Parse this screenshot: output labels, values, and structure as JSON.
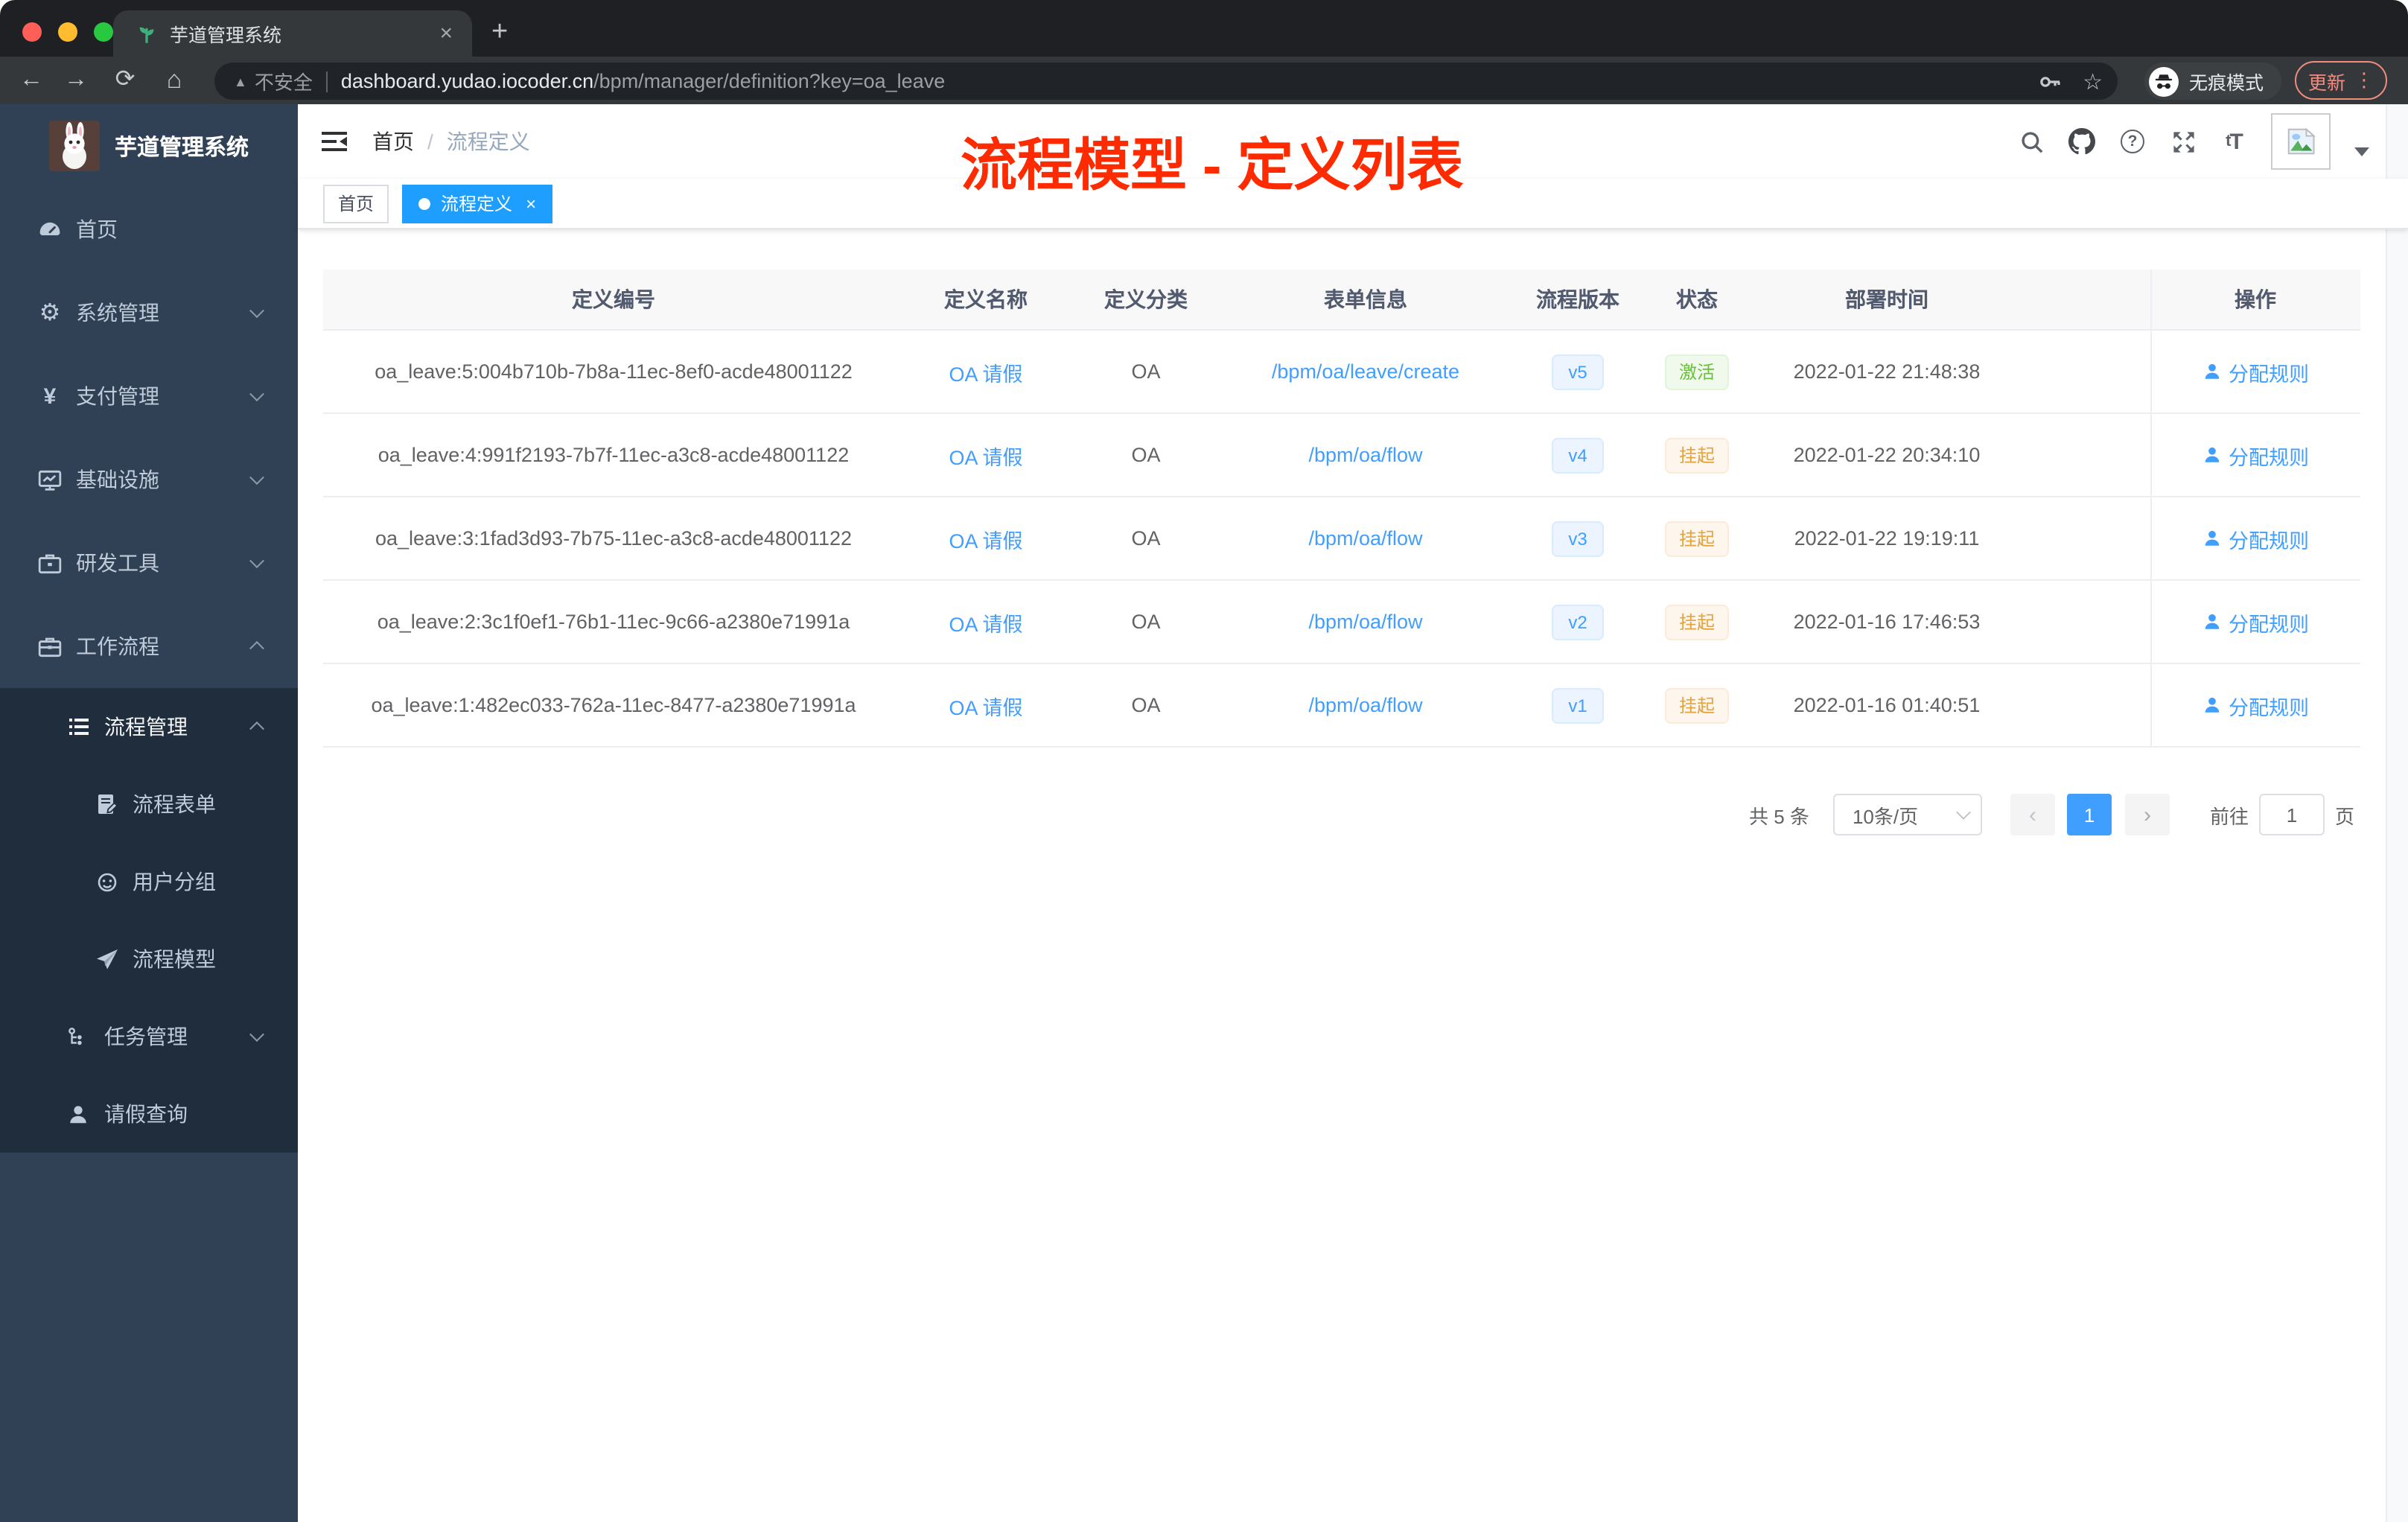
{
  "chrome": {
    "tab_title": "芋道管理系统",
    "not_secure": "不安全",
    "url_host": "dashboard.yudao.iocoder.cn",
    "url_path": "/bpm/manager/definition?key=oa_leave",
    "incognito_label": "无痕模式",
    "update_label": "更新"
  },
  "icons": {
    "back": "←",
    "forward": "→",
    "reload": "⟳",
    "home": "⌂",
    "warning": "▲",
    "star": "☆",
    "new_tab": "+",
    "close": "×",
    "more": "⋮",
    "gear": "⚙",
    "yen": "¥",
    "help": "?",
    "text_small": "t",
    "text_large": "T"
  },
  "sidebar": {
    "app_title": "芋道管理系统",
    "menu": [
      {
        "label": "首页"
      },
      {
        "label": "系统管理"
      },
      {
        "label": "支付管理"
      },
      {
        "label": "基础设施"
      },
      {
        "label": "研发工具"
      },
      {
        "label": "工作流程"
      }
    ],
    "submenu": [
      {
        "label": "流程管理"
      },
      {
        "label": "流程表单"
      },
      {
        "label": "用户分组"
      },
      {
        "label": "流程模型"
      },
      {
        "label": "任务管理"
      },
      {
        "label": "请假查询"
      }
    ]
  },
  "navbar": {
    "breadcrumb_home": "首页",
    "breadcrumb_sep": "/",
    "breadcrumb_current": "流程定义",
    "annotation": "流程模型 - 定义列表"
  },
  "tags": {
    "home": "首页",
    "active": "流程定义"
  },
  "table": {
    "columns": [
      "定义编号",
      "定义名称",
      "定义分类",
      "表单信息",
      "流程版本",
      "状态",
      "部署时间",
      "操作"
    ],
    "rows": [
      {
        "id": "oa_leave:5:004b710b-7b8a-11ec-8ef0-acde48001122",
        "name": "OA 请假",
        "category": "OA",
        "form": "/bpm/oa/leave/create",
        "version": "v5",
        "status": "激活",
        "status_type": "success",
        "deploy_time": "2022-01-22 21:48:38",
        "action": "分配规则"
      },
      {
        "id": "oa_leave:4:991f2193-7b7f-11ec-a3c8-acde48001122",
        "name": "OA 请假",
        "category": "OA",
        "form": "/bpm/oa/flow",
        "version": "v4",
        "status": "挂起",
        "status_type": "warning",
        "deploy_time": "2022-01-22 20:34:10",
        "action": "分配规则"
      },
      {
        "id": "oa_leave:3:1fad3d93-7b75-11ec-a3c8-acde48001122",
        "name": "OA 请假",
        "category": "OA",
        "form": "/bpm/oa/flow",
        "version": "v3",
        "status": "挂起",
        "status_type": "warning",
        "deploy_time": "2022-01-22 19:19:11",
        "action": "分配规则"
      },
      {
        "id": "oa_leave:2:3c1f0ef1-76b1-11ec-9c66-a2380e71991a",
        "name": "OA 请假",
        "category": "OA",
        "form": "/bpm/oa/flow",
        "version": "v2",
        "status": "挂起",
        "status_type": "warning",
        "deploy_time": "2022-01-16 17:46:53",
        "action": "分配规则"
      },
      {
        "id": "oa_leave:1:482ec033-762a-11ec-8477-a2380e71991a",
        "name": "OA 请假",
        "category": "OA",
        "form": "/bpm/oa/flow",
        "version": "v1",
        "status": "挂起",
        "status_type": "warning",
        "deploy_time": "2022-01-16 01:40:51",
        "action": "分配规则"
      }
    ]
  },
  "pagination": {
    "total": "共 5 条",
    "page_size": "10条/页",
    "prev": "‹",
    "page": "1",
    "next": "›",
    "goto_label": "前往",
    "goto_value": "1",
    "unit": "页"
  },
  "colors": {
    "accent": "#409eff",
    "success": "#67c23a",
    "warning": "#e6a23c",
    "tag_active": "#1e9fff",
    "sidebar_bg": "#304156",
    "submenu_bg": "#1f2d3d",
    "annotation": "#fe2b00"
  }
}
